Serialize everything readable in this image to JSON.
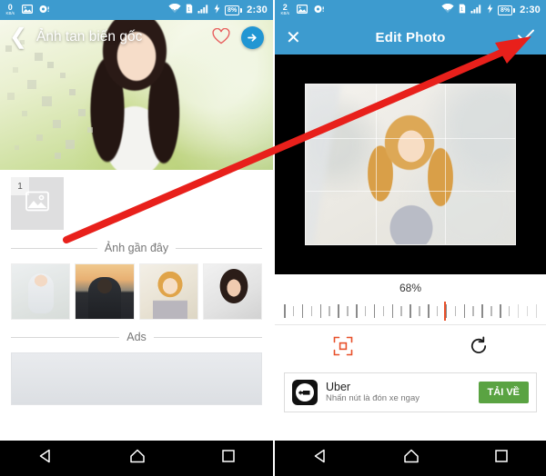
{
  "left": {
    "status": {
      "speed_value": "0",
      "speed_unit": "KB/s",
      "icons": [
        "gallery-icon",
        "record-icon",
        "wifi-icon",
        "sim-icon",
        "signal-icon",
        "charging-icon"
      ],
      "battery": "8%",
      "clock": "2:30"
    },
    "appbar": {
      "back_icon": "chevron-left-icon",
      "title": "Ảnh tan biến  gốc",
      "favorite_icon": "heart-outline-icon",
      "next_icon": "arrow-right-icon"
    },
    "thumb": {
      "badge": "1",
      "icon": "image-placeholder-icon"
    },
    "recent_section_label": "Ảnh gần đây",
    "recents": [
      {
        "name": "recent-photo-baby"
      },
      {
        "name": "recent-photo-man-sunset"
      },
      {
        "name": "recent-photo-girl"
      },
      {
        "name": "recent-photo-woman"
      }
    ],
    "ads_section_label": "Ads"
  },
  "right": {
    "status": {
      "speed_value": "2",
      "speed_unit": "KB/s",
      "battery": "8%",
      "clock": "2:30"
    },
    "appbar": {
      "close_icon": "close-icon",
      "title": "Edit Photo",
      "confirm_icon": "check-icon"
    },
    "slider": {
      "value_label": "68%",
      "percent": 68
    },
    "tools": [
      {
        "name": "crop-tool",
        "icon": "crop-frame-icon",
        "active": true
      },
      {
        "name": "rotate-tool",
        "icon": "rotate-cw-icon",
        "active": false
      }
    ],
    "ad": {
      "title": "Uber",
      "subtitle": "Nhấn nút là đón xe ngay",
      "button": "TẢI VỀ",
      "logo_icon": "uber-logo-icon"
    }
  },
  "navbar": {
    "back": "back-triangle-icon",
    "home": "home-pentagon-icon",
    "recents": "recents-square-icon"
  },
  "annotation": {
    "arrow_color": "#e8201b",
    "from_label": "thumbnail-placeholder",
    "to_label": "confirm-check-button"
  },
  "colors": {
    "accent_blue": "#3d9bcf",
    "accent_orange": "#e8502a",
    "ad_green": "#5aa342",
    "nav_black": "#000000"
  }
}
